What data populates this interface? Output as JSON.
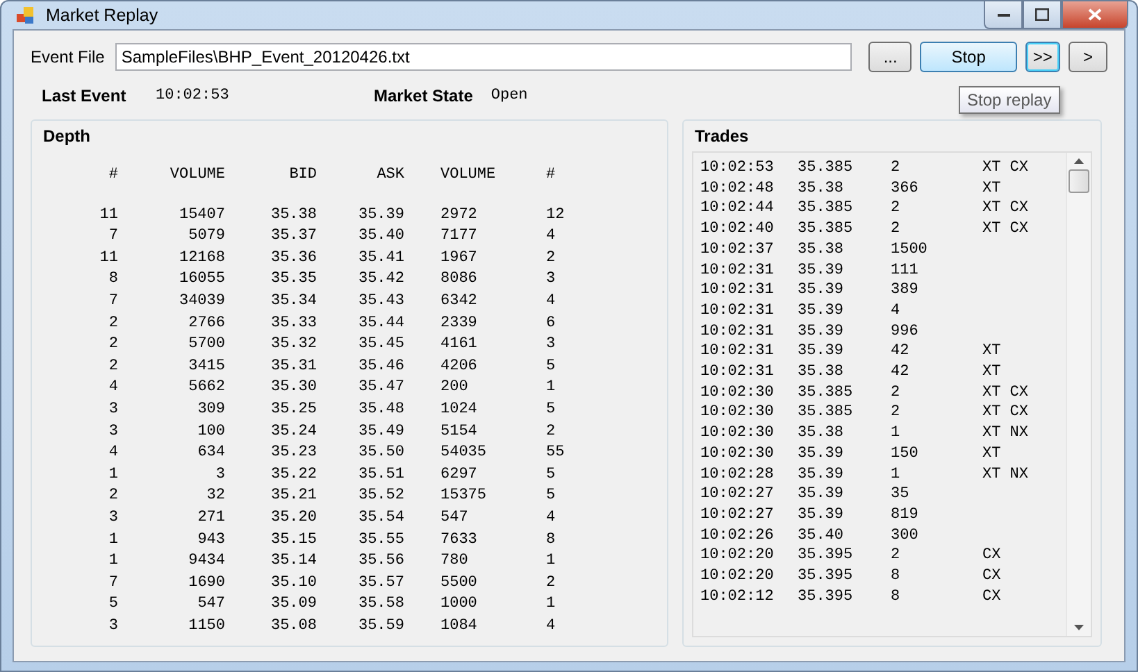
{
  "window": {
    "title": "Market Replay"
  },
  "event_file": {
    "label": "Event File",
    "value": "SampleFiles\\BHP_Event_20120426.txt"
  },
  "buttons": [
    {
      "label": "...",
      "highlighted": false,
      "focused": false
    },
    {
      "label": "Stop",
      "highlighted": true,
      "focused": false
    },
    {
      "label": ">>",
      "highlighted": false,
      "focused": true
    },
    {
      "label": ">",
      "highlighted": false,
      "focused": false
    }
  ],
  "tooltip": "Stop replay",
  "last_event": {
    "label": "Last Event",
    "value": "10:02:53"
  },
  "market_state": {
    "label": "Market State",
    "value": "Open"
  },
  "depth": {
    "title": "Depth",
    "columns": [
      "#",
      "VOLUME",
      "BID",
      "ASK",
      "VOLUME",
      "#"
    ],
    "rows": [
      [
        "11",
        "15407",
        "35.38",
        "35.39",
        "2972",
        "12"
      ],
      [
        "7",
        "5079",
        "35.37",
        "35.40",
        "7177",
        "4"
      ],
      [
        "11",
        "12168",
        "35.36",
        "35.41",
        "1967",
        "2"
      ],
      [
        "8",
        "16055",
        "35.35",
        "35.42",
        "8086",
        "3"
      ],
      [
        "7",
        "34039",
        "35.34",
        "35.43",
        "6342",
        "4"
      ],
      [
        "2",
        "2766",
        "35.33",
        "35.44",
        "2339",
        "6"
      ],
      [
        "2",
        "5700",
        "35.32",
        "35.45",
        "4161",
        "3"
      ],
      [
        "2",
        "3415",
        "35.31",
        "35.46",
        "4206",
        "5"
      ],
      [
        "4",
        "5662",
        "35.30",
        "35.47",
        "200",
        "1"
      ],
      [
        "3",
        "309",
        "35.25",
        "35.48",
        "1024",
        "5"
      ],
      [
        "3",
        "100",
        "35.24",
        "35.49",
        "5154",
        "2"
      ],
      [
        "4",
        "634",
        "35.23",
        "35.50",
        "54035",
        "55"
      ],
      [
        "1",
        "3",
        "35.22",
        "35.51",
        "6297",
        "5"
      ],
      [
        "2",
        "32",
        "35.21",
        "35.52",
        "15375",
        "5"
      ],
      [
        "3",
        "271",
        "35.20",
        "35.54",
        "547",
        "4"
      ],
      [
        "1",
        "943",
        "35.15",
        "35.55",
        "7633",
        "8"
      ],
      [
        "1",
        "9434",
        "35.14",
        "35.56",
        "780",
        "1"
      ],
      [
        "7",
        "1690",
        "35.10",
        "35.57",
        "5500",
        "2"
      ],
      [
        "5",
        "547",
        "35.09",
        "35.58",
        "1000",
        "1"
      ],
      [
        "3",
        "1150",
        "35.08",
        "35.59",
        "1084",
        "4"
      ]
    ]
  },
  "trades": {
    "title": "Trades",
    "rows": [
      {
        "time": "10:02:53",
        "price": "35.385",
        "qty": "2",
        "flags": "XT CX"
      },
      {
        "time": "10:02:48",
        "price": "35.38",
        "qty": "366",
        "flags": "XT"
      },
      {
        "time": "10:02:44",
        "price": "35.385",
        "qty": "2",
        "flags": "XT CX"
      },
      {
        "time": "10:02:40",
        "price": "35.385",
        "qty": "2",
        "flags": "XT CX"
      },
      {
        "time": "10:02:37",
        "price": "35.38",
        "qty": "1500"
      },
      {
        "time": "10:02:31",
        "price": "35.39",
        "qty": "111"
      },
      {
        "time": "10:02:31",
        "price": "35.39",
        "qty": "389"
      },
      {
        "time": "10:02:31",
        "price": "35.39",
        "qty": "4"
      },
      {
        "time": "10:02:31",
        "price": "35.39",
        "qty": "996"
      },
      {
        "time": "10:02:31",
        "price": "35.39",
        "qty": "42",
        "flags": "XT"
      },
      {
        "time": "10:02:31",
        "price": "35.38",
        "qty": "42",
        "flags": "XT"
      },
      {
        "time": "10:02:30",
        "price": "35.385",
        "qty": "2",
        "flags": "XT CX"
      },
      {
        "time": "10:02:30",
        "price": "35.385",
        "qty": "2",
        "flags": "XT CX"
      },
      {
        "time": "10:02:30",
        "price": "35.38",
        "qty": "1",
        "flags": "XT NX"
      },
      {
        "time": "10:02:30",
        "price": "35.39",
        "qty": "150",
        "flags": "XT"
      },
      {
        "time": "10:02:28",
        "price": "35.39",
        "qty": "1",
        "flags": "XT NX"
      },
      {
        "time": "10:02:27",
        "price": "35.39",
        "qty": "35"
      },
      {
        "time": "10:02:27",
        "price": "35.39",
        "qty": "819"
      },
      {
        "time": "10:02:26",
        "price": "35.40",
        "qty": "300"
      },
      {
        "time": "10:02:20",
        "price": "35.395",
        "qty": "2",
        "flags": "CX"
      },
      {
        "time": "10:02:20",
        "price": "35.395",
        "qty": "8",
        "flags": "CX"
      },
      {
        "time": "10:02:12",
        "price": "35.395",
        "qty": "8",
        "flags": "CX"
      }
    ]
  }
}
